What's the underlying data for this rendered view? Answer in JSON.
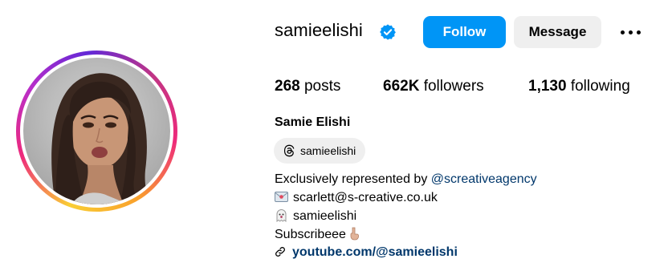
{
  "profile": {
    "username": "samieelishi",
    "full_name": "Samie Elishi",
    "verified": true
  },
  "actions": {
    "follow_label": "Follow",
    "message_label": "Message"
  },
  "stats": {
    "posts_count": "268",
    "posts_label": "posts",
    "followers_count": "662K",
    "followers_label": "followers",
    "following_count": "1,130",
    "following_label": "following"
  },
  "threads_badge": {
    "label": "samieelishi",
    "icon": "threads-icon"
  },
  "bio": {
    "line1_prefix": "Exclusively represented by ",
    "line1_mention": "@screativeagency",
    "email": "scarlett@s-creative.co.uk",
    "email_icon": "envelope-emoji",
    "snapchat": "samieelishi",
    "snapchat_icon": "ghost-emoji",
    "subscribe_text": "Subscribeee",
    "subscribe_icon": "point-down-emoji",
    "link_text": "youtube.com/@samieelishi",
    "link_icon": "link-icon"
  },
  "colors": {
    "follow_bg": "#0095f6",
    "message_bg": "#efefef",
    "verified": "#0095f6",
    "link": "#00376b"
  }
}
